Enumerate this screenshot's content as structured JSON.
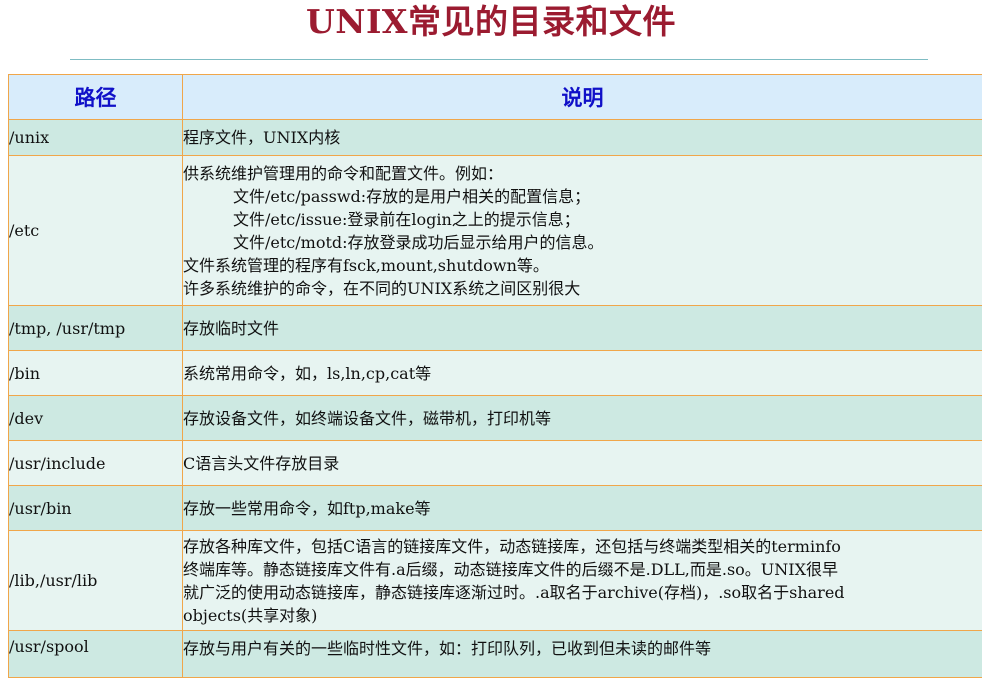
{
  "title": "UNIX常见的目录和文件",
  "colors": {
    "title": "#9b1b30",
    "header_bg": "#d8ecfb",
    "header_text": "#1010c8",
    "row_dark": "#cde9e2",
    "row_light": "#e7f4f1",
    "border": "#f0a64a",
    "rule": "#7fbcc3"
  },
  "table": {
    "headers": [
      "路径",
      "说明"
    ],
    "rows": [
      {
        "path": "/unix",
        "lines": [
          "程序文件，UNIX内核"
        ]
      },
      {
        "path": "/etc",
        "lines": [
          "供系统维护管理用的命令和配置文件。例如：",
          "文件/etc/passwd:存放的是用户相关的配置信息；",
          "文件/etc/issue:登录前在login之上的提示信息；",
          "文件/etc/motd:存放登录成功后显示给用户的信息。",
          "文件系统管理的程序有fsck,mount,shutdown等。",
          "许多系统维护的命令，在不同的UNIX系统之间区别很大"
        ]
      },
      {
        "path": "/tmp, /usr/tmp",
        "lines": [
          "存放临时文件"
        ]
      },
      {
        "path": "/bin",
        "lines": [
          "系统常用命令，如，ls,ln,cp,cat等"
        ]
      },
      {
        "path": "/dev",
        "lines": [
          "存放设备文件，如终端设备文件，磁带机，打印机等"
        ]
      },
      {
        "path": "/usr/include",
        "lines": [
          "C语言头文件存放目录"
        ]
      },
      {
        "path": "/usr/bin",
        "lines": [
          "存放一些常用命令，如ftp,make等"
        ]
      },
      {
        "path": "/lib,/usr/lib",
        "lines": [
          "存放各种库文件，包括C语言的链接库文件，动态链接库，还包括与终端类型相关的terminfo",
          "终端库等。静态链接库文件有.a后缀，动态链接库文件的后缀不是.DLL,而是.so。UNIX很早",
          "就广泛的使用动态链接库，静态链接库逐渐过时。.a取名于archive(存档)，.so取名于shared",
          "objects(共享对象)"
        ]
      },
      {
        "path": "/usr/spool",
        "lines": [
          "存放与用户有关的一些临时性文件，如：打印队列，已收到但未读的邮件等"
        ]
      }
    ]
  }
}
